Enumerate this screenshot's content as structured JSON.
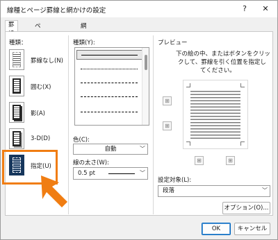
{
  "window": {
    "title": "線種とページ罫線と網かけの設定",
    "help_glyph": "?",
    "close_glyph": "✕"
  },
  "tabs": [
    {
      "label": "罫線"
    },
    {
      "label": "ページ罫線"
    },
    {
      "label": "網かけ"
    }
  ],
  "setting": {
    "heading": "種類：",
    "items": [
      {
        "label": "罫線なし(N)",
        "icon": "no-border-icon"
      },
      {
        "label": "囲む(X)",
        "icon": "box-border-icon"
      },
      {
        "label": "影(A)",
        "icon": "shadow-border-icon"
      },
      {
        "label": "3-D(D)",
        "icon": "three-d-border-icon"
      },
      {
        "label": "指定(U)",
        "icon": "custom-border-icon"
      }
    ],
    "selected": "指定(U)"
  },
  "style": {
    "heading": "種類(Y):",
    "lines": [
      "solid",
      "dotted",
      "dashed",
      "dash-dot",
      "dash-dot-dot"
    ],
    "selected": "solid"
  },
  "color": {
    "label": "色(C):",
    "value": "自動"
  },
  "width": {
    "label": "線の太さ(W):",
    "value": "0.5 pt"
  },
  "preview": {
    "heading": "プレビュー",
    "instruction_line1": "下の絵の中、またはボタンをクリッ",
    "instruction_line2": "クして、罫線を引く位置を指定し",
    "instruction_line3": "てください。"
  },
  "apply_to": {
    "label": "設定対象(L):",
    "value": "段落"
  },
  "buttons": {
    "options": "オプション(O)...",
    "ok": "OK",
    "cancel": "キャンセル"
  },
  "colors": {
    "highlight": "#f07d12",
    "custom_icon_bg": "#16365c",
    "ok_border": "#0067c0"
  }
}
